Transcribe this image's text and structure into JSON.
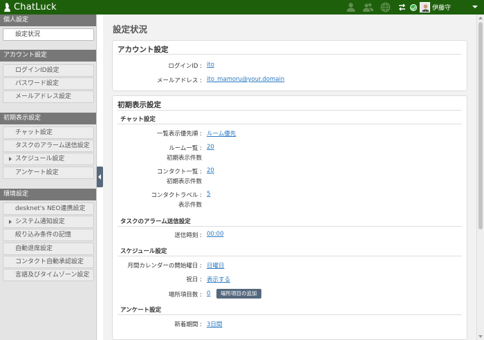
{
  "app": {
    "brand": "ChatLuck",
    "accent": "#1e5f0c"
  },
  "topbar": {
    "icons": [
      "person-icon",
      "people-icon",
      "globe-icon",
      "swap-icon"
    ],
    "user": {
      "name": "伊藤守",
      "status": "online",
      "status_color": "#3cb64a"
    }
  },
  "sidebar": {
    "sections": [
      {
        "title": "個人設定",
        "items": [
          {
            "label": "設定状況",
            "active": true
          }
        ]
      },
      {
        "title": "アカウント設定",
        "items": [
          {
            "label": "ログインID設定"
          },
          {
            "label": "パスワード設定"
          },
          {
            "label": "メールアドレス設定"
          }
        ]
      },
      {
        "title": "初期表示設定",
        "items": [
          {
            "label": "チャット設定"
          },
          {
            "label": "タスクのアラーム送信設定"
          },
          {
            "label": "スケジュール設定",
            "bullet": true
          },
          {
            "label": "アンケート設定"
          }
        ]
      },
      {
        "title": "環境設定",
        "items": [
          {
            "label": "desknet's NEO連携設定"
          },
          {
            "label": "システム通知設定",
            "bullet": true
          },
          {
            "label": "絞り込み条件の記憶"
          },
          {
            "label": "自動退席設定"
          },
          {
            "label": "コンタクト自動承認設定"
          },
          {
            "label": "言語及びタイムゾーン設定"
          }
        ]
      }
    ]
  },
  "main": {
    "title": "設定状況",
    "account": {
      "title": "アカウント設定",
      "login_id_label": "ログインID :",
      "login_id_value": "ito",
      "email_label": "メールアドレス :",
      "email_value": "ito_mamoru@your.domain"
    },
    "initial": {
      "title": "初期表示設定",
      "chat": {
        "title": "チャット設定",
        "order_label": "一覧表示優先順 :",
        "order_value": "ルーム優先",
        "room_label": "ルーム一覧 :",
        "room_sub": "初期表示件数",
        "room_value": "20",
        "contact_label": "コンタクト一覧 :",
        "contact_sub": "初期表示件数",
        "contact_value": "20",
        "travel_label": "コンタクトラベル :",
        "travel_sub": "表示件数",
        "travel_value": "5"
      },
      "alarm": {
        "title": "タスクのアラーム送信設定",
        "time_label": "送信時刻 :",
        "time_value": "00:00"
      },
      "schedule": {
        "title": "スケジュール設定",
        "week_label": "月間カレンダーの開始曜日 :",
        "week_value": "日曜日",
        "holiday_label": "祝日 :",
        "holiday_value": "表示する",
        "place_label": "場所項目数 :",
        "place_value": "0",
        "place_button": "場所項目の追加"
      },
      "survey": {
        "title": "アンケート設定",
        "period_label": "新着期間 :",
        "period_value": "3日間"
      }
    }
  }
}
